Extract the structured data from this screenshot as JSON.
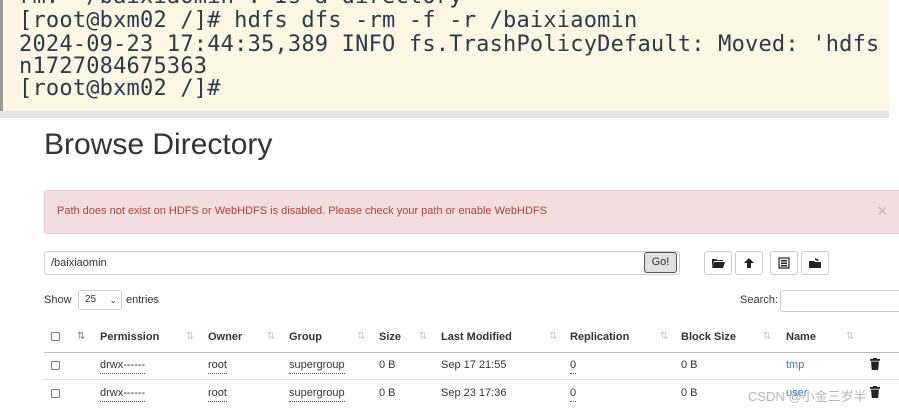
{
  "terminal": {
    "lines": [
      "rm: `/baixiaomin': Is a directory",
      "[root@bxm02 /]# hdfs dfs -rm -f -r /baixiaomin",
      "2024-09-23 17:44:35,389 INFO fs.TrashPolicyDefault: Moved: 'hdfs",
      "n1727084675363",
      "[root@bxm02 /]#"
    ]
  },
  "page": {
    "title": "Browse Directory"
  },
  "alert": {
    "message": "Path does not exist on HDFS or WebHDFS is disabled. Please check your path or enable WebHDFS",
    "close": "×"
  },
  "toolbar": {
    "path_value": "/baixiaomin",
    "go_label": "Go!",
    "icons": [
      "folder-open-icon",
      "upload-icon",
      "list-icon",
      "cut-paste-icon"
    ]
  },
  "table_controls": {
    "show_label": "Show",
    "entries_value": "25",
    "entries_label": "entries",
    "search_label": "Search:"
  },
  "table": {
    "columns": [
      "Permission",
      "Owner",
      "Group",
      "Size",
      "Last Modified",
      "Replication",
      "Block Size",
      "Name"
    ],
    "rows": [
      {
        "permission": "drwx------",
        "owner": "root",
        "group": "supergroup",
        "size": "0 B",
        "modified": "Sep 17 21:55",
        "replication": "0",
        "block_size": "0 B",
        "name": "tmp"
      },
      {
        "permission": "drwx------",
        "owner": "root",
        "group": "supergroup",
        "size": "0 B",
        "modified": "Sep 23 17:36",
        "replication": "0",
        "block_size": "0 B",
        "name": "user"
      }
    ]
  },
  "watermark": "CSDN @小金三岁半",
  "colors": {
    "alert_bg": "#f2dede",
    "alert_text": "#a94442",
    "link": "#337ab7",
    "terminal_bg": "#fbf7e4"
  }
}
